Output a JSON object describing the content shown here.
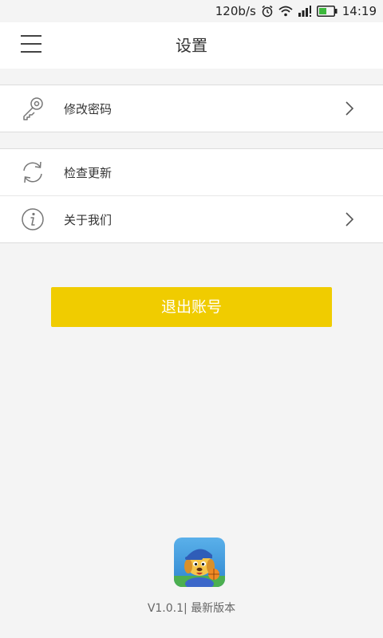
{
  "status_bar": {
    "net_speed": "120b/s",
    "time": "14:19",
    "icons": [
      "alarm-icon",
      "wifi-icon",
      "signal-icon",
      "battery-icon"
    ]
  },
  "header": {
    "title": "设置",
    "menu_icon": "hamburger-menu-icon"
  },
  "settings": {
    "change_password": {
      "label": "修改密码",
      "icon": "key-icon"
    },
    "check_update": {
      "label": "检查更新",
      "icon": "refresh-icon"
    },
    "about": {
      "label": "关于我们",
      "icon": "info-icon"
    }
  },
  "logout_button": {
    "label": "退出账号"
  },
  "footer": {
    "version": "V1.0.1",
    "separator": "|",
    "status": "最新版本"
  },
  "colors": {
    "accent": "#f0cc00",
    "background": "#f4f4f4"
  }
}
